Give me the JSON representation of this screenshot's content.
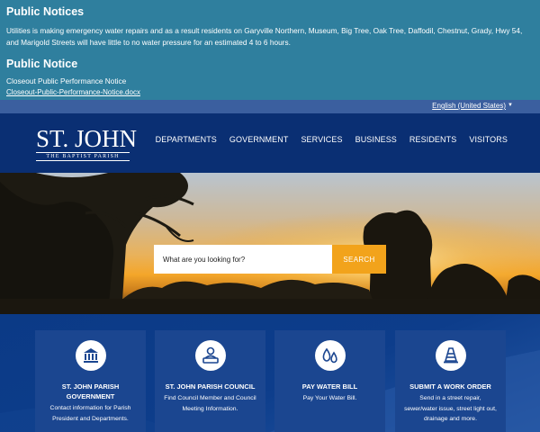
{
  "alerts": {
    "notice1": {
      "title": "Public Notices",
      "text": "Utilities is making emergency water repairs and as a result residents on Garyville Northern, Museum, Big Tree, Oak Tree, Daffodil, Chestnut, Grady, Hwy 54, and Marigold Streets will have little to no water pressure for an estimated 4 to 6 hours."
    },
    "notice2": {
      "title": "Public Notice",
      "text": "Closeout Public Performance Notice",
      "link": "Closeout-Public-Performance-Notice.docx"
    }
  },
  "language": {
    "selected": "English (United States)",
    "caret": "▼"
  },
  "logo": {
    "main": "ST. JOHN",
    "sub": "THE BAPTIST PARISH"
  },
  "nav": {
    "items": [
      "DEPARTMENTS",
      "GOVERNMENT",
      "SERVICES",
      "BUSINESS",
      "RESIDENTS",
      "VISITORS"
    ]
  },
  "search": {
    "placeholder": "What are you looking for?",
    "button": "SEARCH"
  },
  "cards": [
    {
      "icon": "building-icon",
      "title": "ST. JOHN PARISH GOVERNMENT",
      "desc": "Contact information for Parish President and Departments."
    },
    {
      "icon": "council-member-icon",
      "title": "ST. JOHN PARISH COUNCIL",
      "desc": "Find Council Member and Council Meeting Information."
    },
    {
      "icon": "water-drops-icon",
      "title": "PAY WATER BILL",
      "desc": "Pay Your Water Bill."
    },
    {
      "icon": "traffic-cone-icon",
      "title": "SUBMIT A WORK ORDER",
      "desc": "Send in a street repair, sewer/water issue, street light out, drainage and more."
    }
  ],
  "colors": {
    "alert_bg": "#2f7f9e",
    "header_bg": "#0a2f73",
    "search_button": "#f2a31b",
    "card_bg": "#1b4690"
  }
}
